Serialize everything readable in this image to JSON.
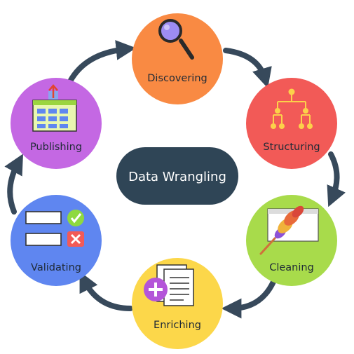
{
  "diagram": {
    "center": {
      "label": "Data Wrangling",
      "color": "#2f4556"
    },
    "arrow_color": "#37495b",
    "stages": [
      {
        "label": "Discovering",
        "color": "#f98a43",
        "icon": "magnifying-glass-icon"
      },
      {
        "label": "Structuring",
        "color": "#f25a57",
        "icon": "hierarchy-tree-icon"
      },
      {
        "label": "Cleaning",
        "color": "#a8db4b",
        "icon": "feather-duster-icon"
      },
      {
        "label": "Enriching",
        "color": "#fcd74a",
        "icon": "documents-plus-icon"
      },
      {
        "label": "Validating",
        "color": "#5f86f0",
        "icon": "checklist-validation-icon"
      },
      {
        "label": "Publishing",
        "color": "#c468e3",
        "icon": "upload-dashboard-icon"
      }
    ]
  }
}
